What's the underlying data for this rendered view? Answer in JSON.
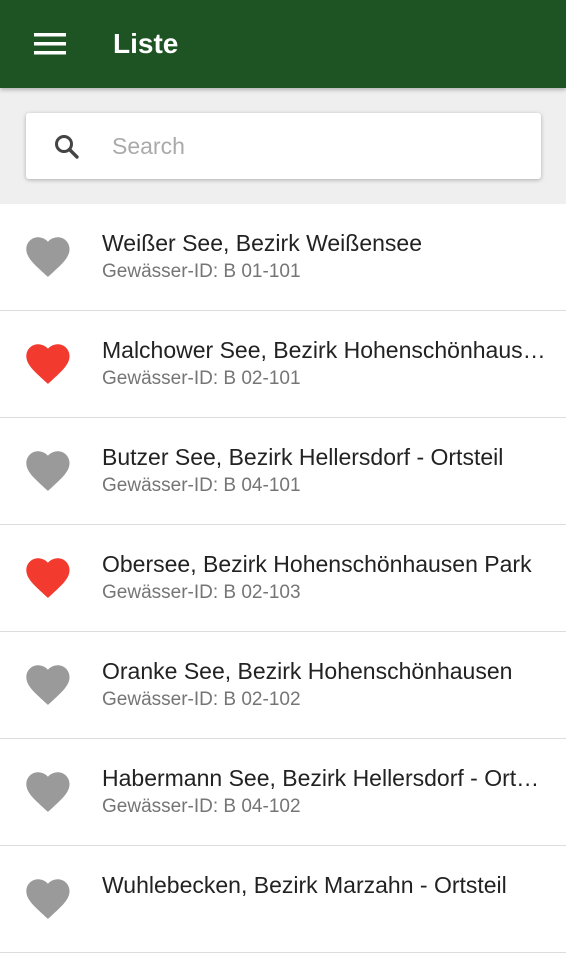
{
  "header": {
    "title": "Liste",
    "menu_icon": "hamburger-menu-icon",
    "background_color": "#1e5423"
  },
  "search": {
    "placeholder": "Search",
    "value": "",
    "icon": "search-icon"
  },
  "colors": {
    "favorite": "#f23a2f",
    "not_favorite": "#9a9a9a"
  },
  "lakes": [
    {
      "name": "Weißer See, Bezirk Weißensee",
      "id_text": "Gewässer-ID: B 01-101",
      "favorite": false
    },
    {
      "name": "Malchower See, Bezirk Hohenschönhausen",
      "id_text": "Gewässer-ID: B 02-101",
      "favorite": true
    },
    {
      "name": "Butzer See, Bezirk Hellersdorf - Ortsteil",
      "id_text": "Gewässer-ID: B 04-101",
      "favorite": false
    },
    {
      "name": "Obersee, Bezirk Hohenschönhausen Park",
      "id_text": "Gewässer-ID: B 02-103",
      "favorite": true
    },
    {
      "name": "Oranke See, Bezirk Hohenschönhausen",
      "id_text": "Gewässer-ID: B 02-102",
      "favorite": false
    },
    {
      "name": "Habermann See, Bezirk Hellersdorf - Ortsteil",
      "id_text": "Gewässer-ID: B 04-102",
      "favorite": false
    },
    {
      "name": "Wuhlebecken, Bezirk Marzahn - Ortsteil",
      "id_text": "",
      "favorite": false
    }
  ]
}
